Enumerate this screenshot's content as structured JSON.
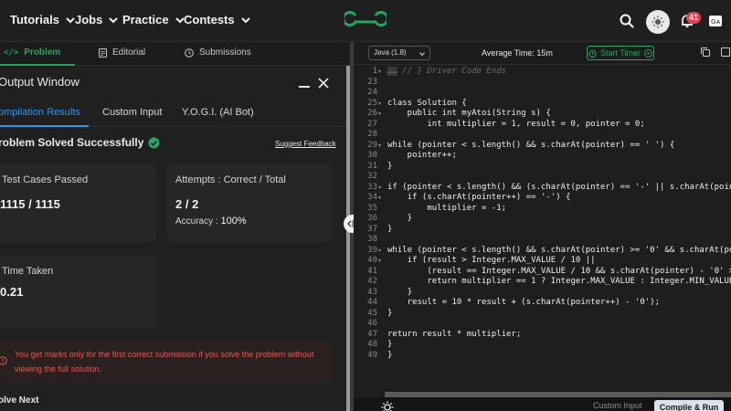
{
  "nav": {
    "items": [
      {
        "label": "Tutorials"
      },
      {
        "label": "Jobs"
      },
      {
        "label": "Practice"
      },
      {
        "label": "Contests"
      }
    ],
    "notification_count": "41",
    "icons": [
      "search-icon",
      "theme-toggle-icon",
      "bell-icon",
      "translate-icon"
    ]
  },
  "problem_tabs": [
    {
      "label": "Problem"
    },
    {
      "label": "Editorial"
    },
    {
      "label": "Submissions"
    }
  ],
  "output_window": {
    "title": "Output Window",
    "tabs": [
      {
        "label": "ompilation Results"
      },
      {
        "label": "Custom Input"
      },
      {
        "label": "Y.O.G.I. (AI Bot)"
      }
    ],
    "status": "roblem Solved Successfully",
    "feedback_link": "Suggest Feedback",
    "test_cases": {
      "label": "Test Cases Passed",
      "value": "1115 / 1115"
    },
    "attempts": {
      "label": "Attempts : Correct / Total",
      "value": "2 / 2",
      "accuracy_label": "Accuracy :",
      "accuracy_value": "100%"
    },
    "time_taken": {
      "label": "Time Taken",
      "value": "0.21"
    },
    "warning": "You get marks only for the first correct submission if you solve the problem without viewing the full solution.",
    "solve_next": "olve Next"
  },
  "editor": {
    "language": "Java (1.8)",
    "average_time": "Average Time: 15m",
    "start_timer": "Start Timer",
    "custom_input": "Custom Input",
    "compile_run": "Compile & Run",
    "lines": [
      {
        "n": "1",
        "text": "// } Driver Code Ends",
        "type": "comment",
        "fold": true
      },
      {
        "n": "23",
        "text": ""
      },
      {
        "n": "24",
        "text": ""
      },
      {
        "n": "25",
        "text": "class Solution {",
        "fold": true
      },
      {
        "n": "26",
        "text": "    public int myAtoi(String s) {",
        "fold": true
      },
      {
        "n": "27",
        "text": "        int multiplier = 1, result = 0, pointer = 0;"
      },
      {
        "n": "28",
        "text": ""
      },
      {
        "n": "29",
        "text": "while (pointer < s.length() && s.charAt(pointer) == ' ') {",
        "fold": true
      },
      {
        "n": "30",
        "text": "    pointer++;"
      },
      {
        "n": "31",
        "text": "}"
      },
      {
        "n": "32",
        "text": ""
      },
      {
        "n": "33",
        "text": "if (pointer < s.length() && (s.charAt(pointer) == '-' || s.charAt(pointer",
        "fold": true
      },
      {
        "n": "34",
        "text": "    if (s.charAt(pointer++) == '-') {",
        "fold": true
      },
      {
        "n": "35",
        "text": "        multiplier = -1;"
      },
      {
        "n": "36",
        "text": "    }"
      },
      {
        "n": "37",
        "text": "}"
      },
      {
        "n": "38",
        "text": ""
      },
      {
        "n": "39",
        "text": "while (pointer < s.length() && s.charAt(pointer) >= '0' && s.charAt(poi",
        "fold": true
      },
      {
        "n": "40",
        "text": "    if (result > Integer.MAX_VALUE / 10 ||",
        "fold": true
      },
      {
        "n": "41",
        "text": "        (result == Integer.MAX_VALUE / 10 && s.charAt(pointer) - '0' >"
      },
      {
        "n": "42",
        "text": "        return multiplier == 1 ? Integer.MAX_VALUE : Integer.MIN_VALUE;"
      },
      {
        "n": "43",
        "text": "    }"
      },
      {
        "n": "44",
        "text": "    result = 10 * result + (s.charAt(pointer++) - '0');"
      },
      {
        "n": "45",
        "text": "}"
      },
      {
        "n": "46",
        "text": ""
      },
      {
        "n": "47",
        "text": "return result * multiplier;"
      },
      {
        "n": "48",
        "text": "}"
      },
      {
        "n": "49",
        "text": "}"
      }
    ]
  },
  "colors": {
    "accent_green": "#2aa362",
    "accent_blue": "#2f95e8",
    "warning_red": "#e05a5a",
    "badge_red": "#e2404e"
  }
}
